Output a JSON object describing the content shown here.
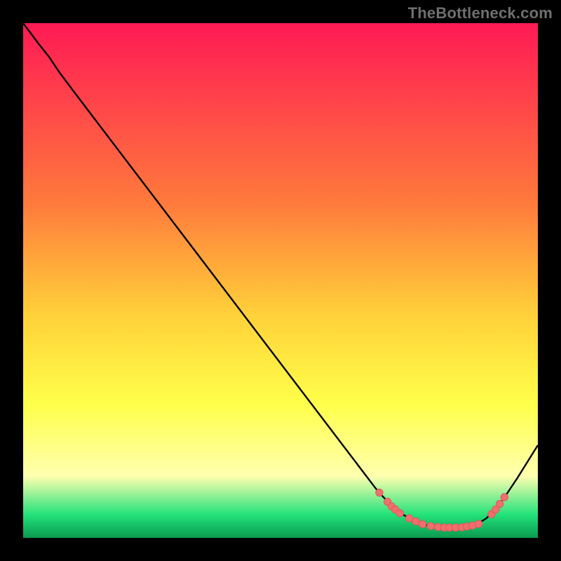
{
  "watermark": "TheBottleneck.com",
  "colors": {
    "bg": "#000000",
    "curve": "#000000",
    "marker_fill": "#ef6e6e",
    "marker_stroke": "#e05858",
    "grad_top": "#ff1a55",
    "grad_mid1": "#ff7a3c",
    "grad_mid2": "#ffd23a",
    "grad_mid3": "#ffff4a",
    "grad_yellowwhite": "#ffffb0",
    "grad_green": "#23e27a",
    "grad_green_dark": "#0a9a50"
  },
  "chart_data": {
    "type": "line",
    "title": "",
    "xlabel": "",
    "ylabel": "",
    "xlim": [
      0,
      100
    ],
    "ylim": [
      0,
      100
    ],
    "curve": [
      {
        "x": 0,
        "y": 100
      },
      {
        "x": 3,
        "y": 96
      },
      {
        "x": 5,
        "y": 93.5
      },
      {
        "x": 7,
        "y": 90.5
      },
      {
        "x": 10,
        "y": 86.5
      },
      {
        "x": 68.5,
        "y": 9.6
      },
      {
        "x": 70,
        "y": 7.9
      },
      {
        "x": 72,
        "y": 5.9
      },
      {
        "x": 74,
        "y": 4.4
      },
      {
        "x": 76,
        "y": 3.3
      },
      {
        "x": 78,
        "y": 2.55
      },
      {
        "x": 80,
        "y": 2.15
      },
      {
        "x": 82,
        "y": 2.0
      },
      {
        "x": 84,
        "y": 2.0
      },
      {
        "x": 86,
        "y": 2.15
      },
      {
        "x": 88,
        "y": 2.55
      },
      {
        "x": 90,
        "y": 3.8
      },
      {
        "x": 92,
        "y": 5.8
      },
      {
        "x": 94,
        "y": 8.6
      },
      {
        "x": 96,
        "y": 11.6
      },
      {
        "x": 98,
        "y": 14.8
      },
      {
        "x": 100,
        "y": 18.0
      }
    ],
    "markers": [
      {
        "x": 69.2,
        "y": 8.8
      },
      {
        "x": 70.8,
        "y": 7.0
      },
      {
        "x": 71.6,
        "y": 6.1
      },
      {
        "x": 72.3,
        "y": 5.5
      },
      {
        "x": 73.2,
        "y": 4.8
      },
      {
        "x": 75.0,
        "y": 3.8
      },
      {
        "x": 76.3,
        "y": 3.2
      },
      {
        "x": 77.6,
        "y": 2.65
      },
      {
        "x": 79.2,
        "y": 2.3
      },
      {
        "x": 80.6,
        "y": 2.1
      },
      {
        "x": 81.8,
        "y": 2.0
      },
      {
        "x": 82.8,
        "y": 2.0
      },
      {
        "x": 84.0,
        "y": 2.0
      },
      {
        "x": 85.2,
        "y": 2.05
      },
      {
        "x": 86.2,
        "y": 2.2
      },
      {
        "x": 87.3,
        "y": 2.4
      },
      {
        "x": 88.5,
        "y": 2.7
      },
      {
        "x": 91.0,
        "y": 4.6
      },
      {
        "x": 91.8,
        "y": 5.5
      },
      {
        "x": 92.6,
        "y": 6.6
      },
      {
        "x": 93.5,
        "y": 7.9
      }
    ],
    "gradient_stops": [
      {
        "offset": 0.0,
        "color_key": "grad_top"
      },
      {
        "offset": 0.35,
        "color_key": "grad_mid1"
      },
      {
        "offset": 0.57,
        "color_key": "grad_mid2"
      },
      {
        "offset": 0.74,
        "color_key": "grad_mid3"
      },
      {
        "offset": 0.88,
        "color_key": "grad_yellowwhite"
      },
      {
        "offset": 0.955,
        "color_key": "grad_green"
      },
      {
        "offset": 1.0,
        "color_key": "grad_green_dark"
      }
    ]
  }
}
